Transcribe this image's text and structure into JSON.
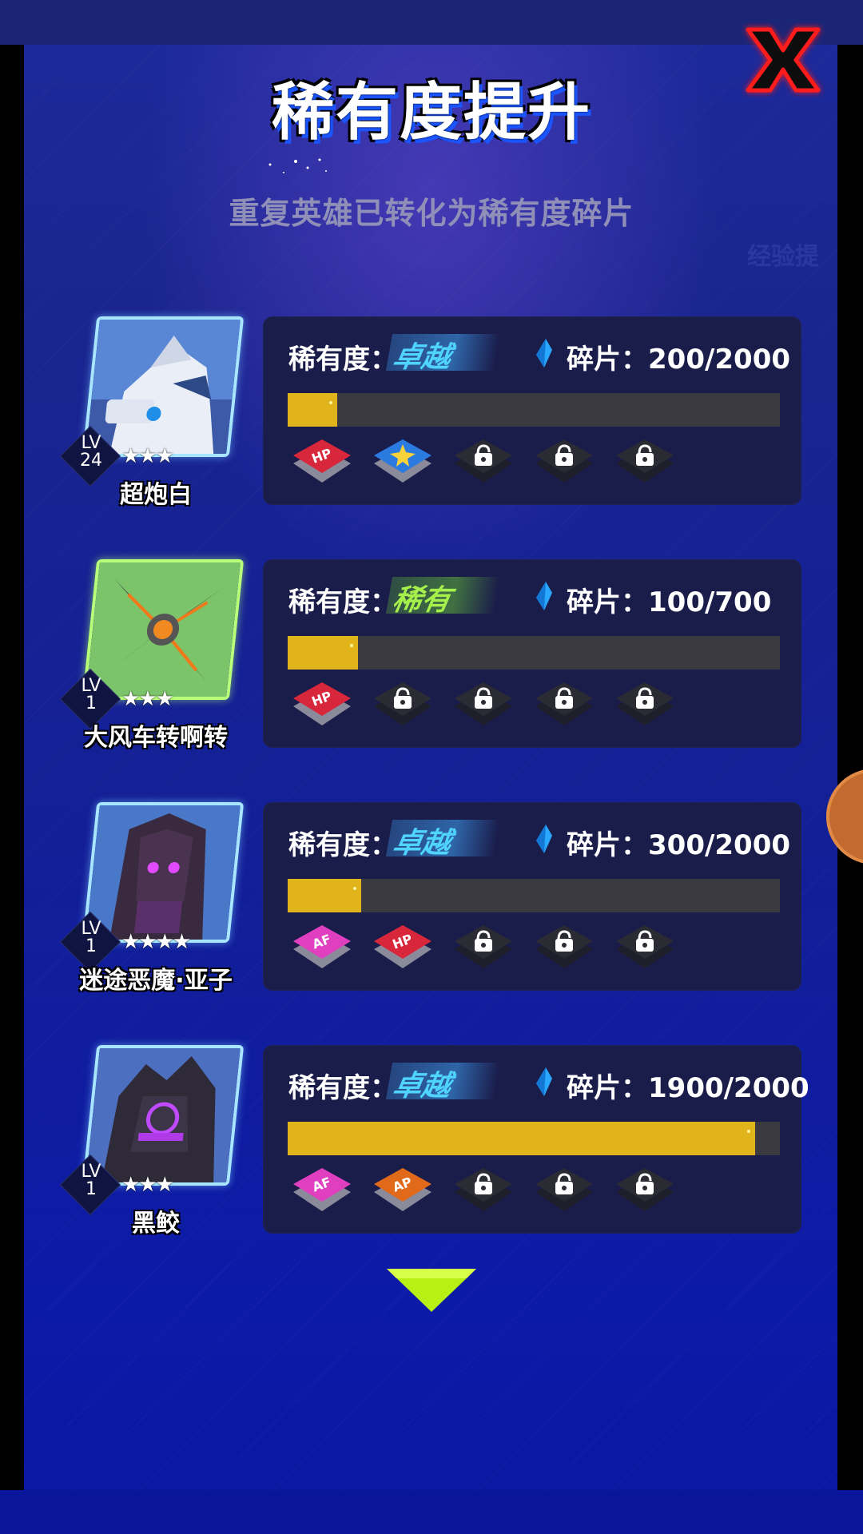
{
  "title": "稀有度提升",
  "subtitle": "重复英雄已转化为稀有度碎片",
  "background_hint": "经验提",
  "rarity_label": "稀有度：",
  "shard_label": "碎片：",
  "colors": {
    "bar_fill": "#e0b41a",
    "bar_track": "#3a3a40",
    "card_bg": "#1a1c4a",
    "rarity_blue": "#4fd4ff",
    "rarity_green": "#a6f04c",
    "close_red": "#ff1a1a"
  },
  "heroes": [
    {
      "name": "超炮白",
      "lv_label": "LV",
      "level": "24",
      "stars": "★★★",
      "rarity": "卓越",
      "rarity_color": "blue",
      "shards": "200/2000",
      "progress": 0.1,
      "skills": [
        {
          "icon": "hp-skill-icon",
          "label": "HP",
          "locked": false
        },
        {
          "icon": "shield-skill-icon",
          "label": "",
          "locked": false
        },
        {
          "icon": "lock-icon",
          "label": "",
          "locked": true
        },
        {
          "icon": "lock-icon",
          "label": "",
          "locked": true
        },
        {
          "icon": "lock-icon",
          "label": "",
          "locked": true
        }
      ]
    },
    {
      "name": "大风车转啊转",
      "lv_label": "LV",
      "level": "1",
      "stars": "★★★",
      "rarity": "稀有",
      "rarity_color": "green",
      "shards": "100/700",
      "progress": 0.143,
      "skills": [
        {
          "icon": "hp-skill-icon",
          "label": "HP",
          "locked": false
        },
        {
          "icon": "lock-icon",
          "label": "",
          "locked": true
        },
        {
          "icon": "lock-icon",
          "label": "",
          "locked": true
        },
        {
          "icon": "lock-icon",
          "label": "",
          "locked": true
        },
        {
          "icon": "lock-icon",
          "label": "",
          "locked": true
        }
      ]
    },
    {
      "name": "迷途恶魔·亚子",
      "lv_label": "LV",
      "level": "1",
      "stars": "★★★★",
      "rarity": "卓越",
      "rarity_color": "blue",
      "shards": "300/2000",
      "progress": 0.15,
      "skills": [
        {
          "icon": "af-skill-icon",
          "label": "AF",
          "locked": false
        },
        {
          "icon": "hp-skill-icon",
          "label": "HP",
          "locked": false
        },
        {
          "icon": "lock-icon",
          "label": "",
          "locked": true
        },
        {
          "icon": "lock-icon",
          "label": "",
          "locked": true
        },
        {
          "icon": "lock-icon",
          "label": "",
          "locked": true
        }
      ]
    },
    {
      "name": "黑鲛",
      "lv_label": "LV",
      "level": "1",
      "stars": "★★★",
      "rarity": "卓越",
      "rarity_color": "blue",
      "shards": "1900/2000",
      "progress": 0.95,
      "skills": [
        {
          "icon": "af-skill-icon",
          "label": "AF",
          "locked": false
        },
        {
          "icon": "ap-skill-icon",
          "label": "AP",
          "locked": false
        },
        {
          "icon": "lock-icon",
          "label": "",
          "locked": true
        },
        {
          "icon": "lock-icon",
          "label": "",
          "locked": true
        },
        {
          "icon": "lock-icon",
          "label": "",
          "locked": true
        }
      ]
    }
  ]
}
